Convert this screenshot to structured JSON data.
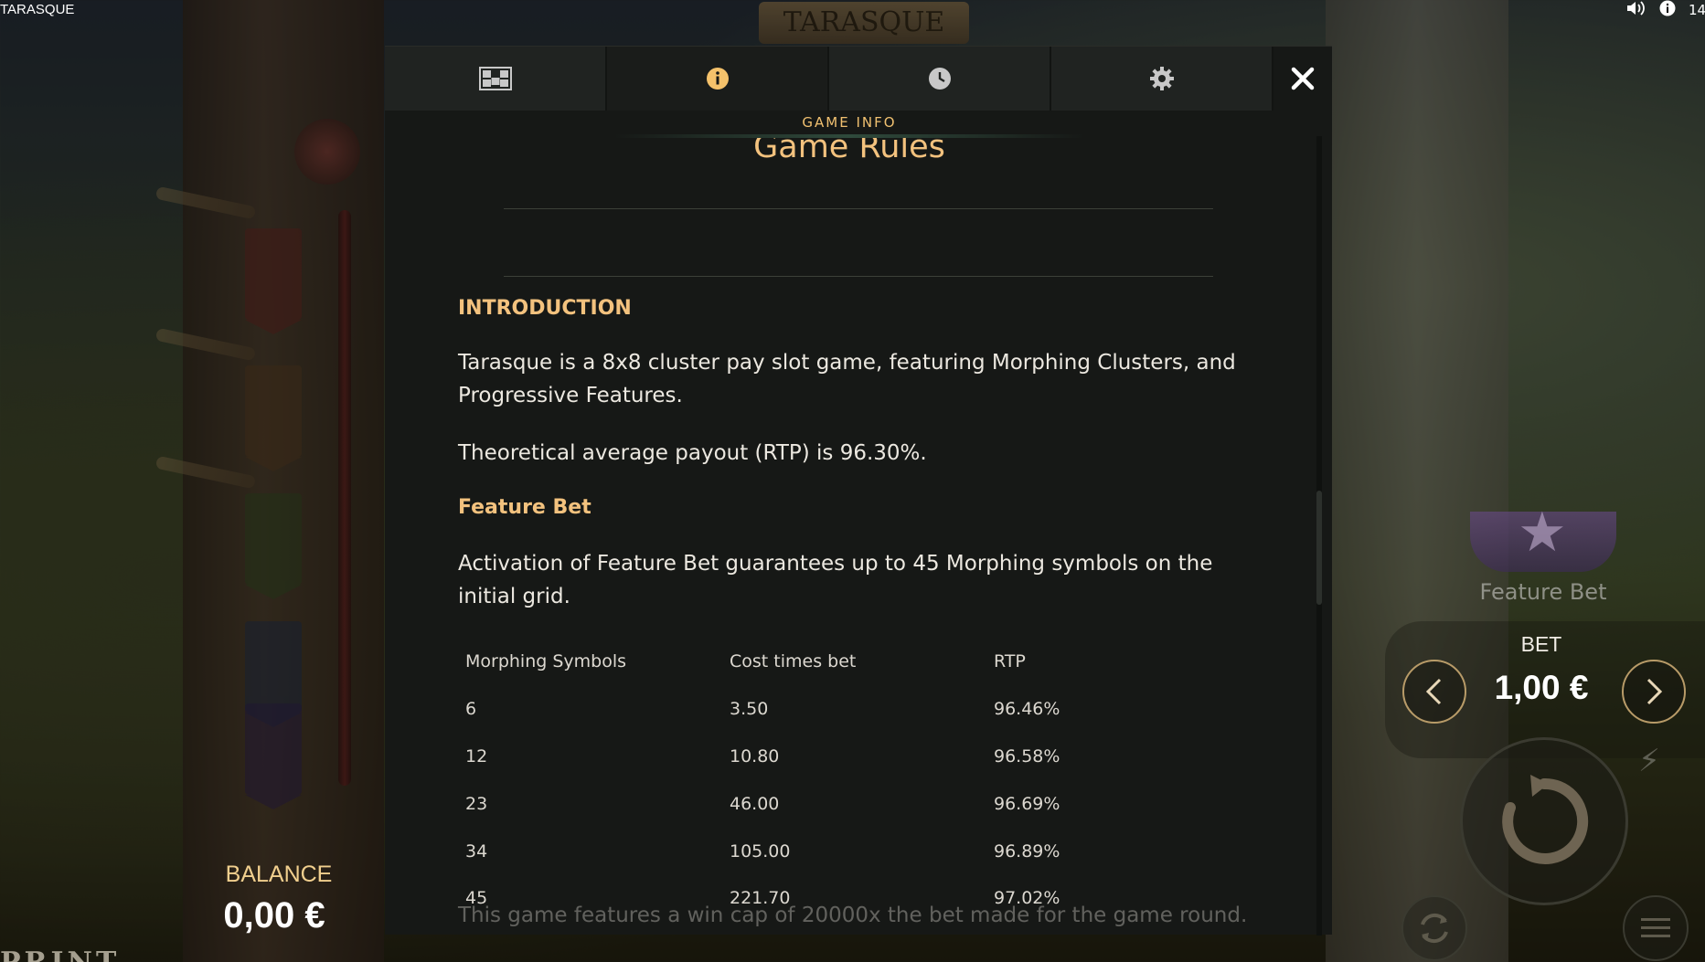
{
  "window": {
    "title": "TARASQUE"
  },
  "game_logo": "TARASQUE",
  "logo_fragment": "PRINT",
  "top_icons": {
    "sound": "speaker-icon",
    "info": "info-icon",
    "clock_fragment": "14:"
  },
  "tabs": [
    {
      "name": "paytable",
      "icon": "grid-icon",
      "active": false
    },
    {
      "name": "info",
      "icon": "info-icon",
      "active": true
    },
    {
      "name": "history",
      "icon": "clock-icon",
      "active": false
    },
    {
      "name": "settings",
      "icon": "gear-icon",
      "active": false
    }
  ],
  "section_label": "GAME INFO",
  "rules": {
    "title": "Game Rules",
    "intro_heading": "INTRODUCTION",
    "intro_text": "Tarasque is a 8x8 cluster pay slot game, featuring Morphing Clusters, and Progressive Features.",
    "rtp_text": "Theoretical average payout (RTP) is 96.30%.",
    "feature_heading": "Feature Bet",
    "feature_text": "Activation of Feature Bet guarantees up to 45 Morphing symbols on the initial grid.",
    "table": {
      "headers": [
        "Morphing Symbols",
        "Cost times bet",
        "RTP"
      ],
      "rows": [
        [
          "6",
          "3.50",
          "96.46%"
        ],
        [
          "12",
          "10.80",
          "96.58%"
        ],
        [
          "23",
          "46.00",
          "96.69%"
        ],
        [
          "34",
          "105.00",
          "96.89%"
        ],
        [
          "45",
          "221.70",
          "97.02%"
        ]
      ]
    },
    "cap_text": "This game features a win cap of 20000x the bet made for the game round."
  },
  "feature_bet_label": "Feature Bet",
  "bet": {
    "label": "BET",
    "value": "1,00 €"
  },
  "balance": {
    "label": "BALANCE",
    "value": "0,00 €"
  },
  "colors": {
    "accent": "#f3c27e",
    "panel": "#161816",
    "tab": "#202321"
  }
}
